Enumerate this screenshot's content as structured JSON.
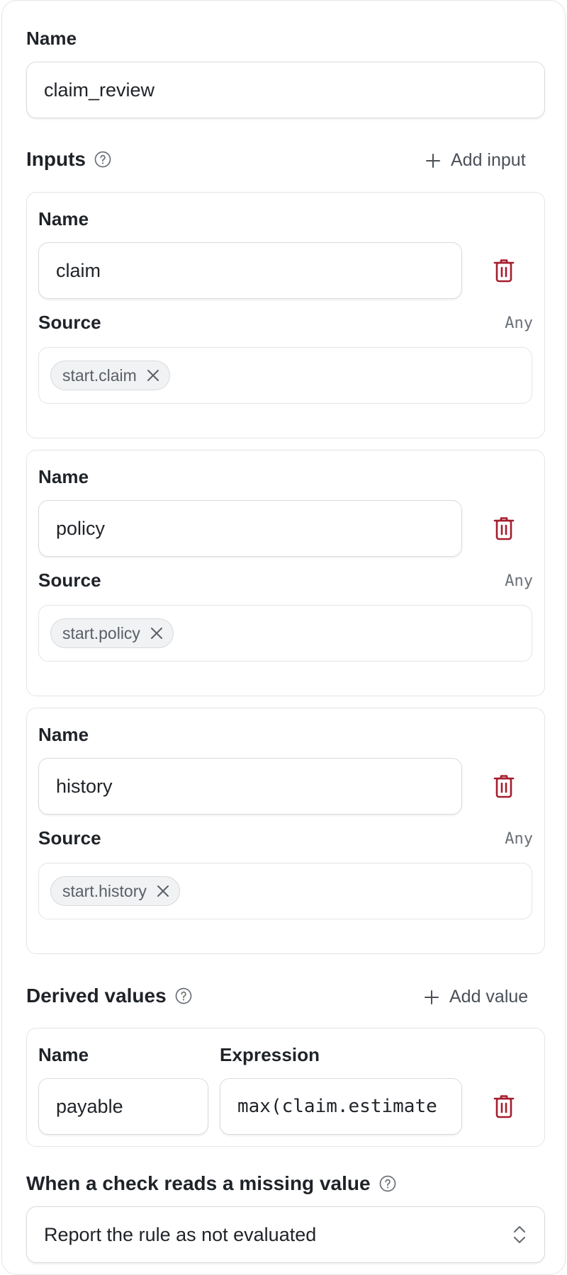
{
  "name_field": {
    "label": "Name",
    "value": "claim_review"
  },
  "inputs_section": {
    "title": "Inputs",
    "add_label": "Add input",
    "items": [
      {
        "name_label": "Name",
        "name_value": "claim",
        "source_label": "Source",
        "type_hint": "Any",
        "chip": "start.claim"
      },
      {
        "name_label": "Name",
        "name_value": "policy",
        "source_label": "Source",
        "type_hint": "Any",
        "chip": "start.policy"
      },
      {
        "name_label": "Name",
        "name_value": "history",
        "source_label": "Source",
        "type_hint": "Any",
        "chip": "start.history"
      }
    ]
  },
  "derived_section": {
    "title": "Derived values",
    "add_label": "Add value",
    "items": [
      {
        "name_label": "Name",
        "expression_label": "Expression",
        "name_value": "payable",
        "expression_value": "max(claim.estimate"
      }
    ]
  },
  "missing_section": {
    "title": "When a check reads a missing value",
    "selected": "Report the rule as not evaluated"
  },
  "colors": {
    "danger": "#a51d2d",
    "border": "#d8dadd",
    "muted": "#6b7077"
  }
}
